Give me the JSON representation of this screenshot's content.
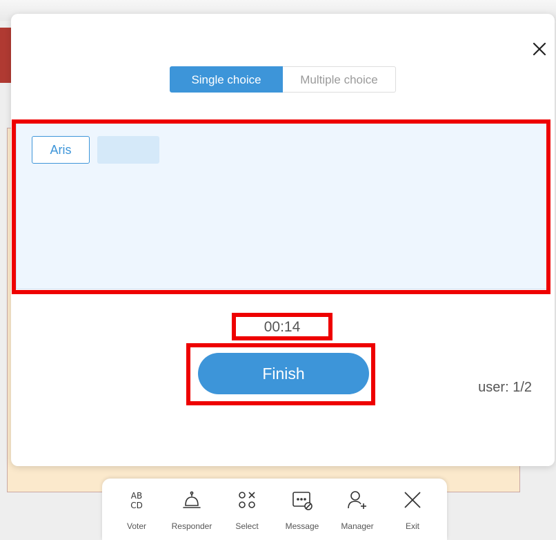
{
  "mode_tabs": [
    {
      "label": "Single choice",
      "active": true
    },
    {
      "label": "Multiple choice",
      "active": false
    }
  ],
  "responses": {
    "chips": [
      "Aris",
      ""
    ],
    "user_count": "user: 1/2"
  },
  "timer": "00:14",
  "finish_label": "Finish",
  "toolbar": [
    {
      "label": "Voter",
      "icon": "abcd-icon"
    },
    {
      "label": "Responder",
      "icon": "bell-icon"
    },
    {
      "label": "Select",
      "icon": "select-icon"
    },
    {
      "label": "Message",
      "icon": "message-icon"
    },
    {
      "label": "Manager",
      "icon": "add-user-icon"
    },
    {
      "label": "Exit",
      "icon": "close-icon"
    }
  ],
  "colors": {
    "accent": "#3d95d9",
    "highlight": "#ee0000",
    "answer_bg": "#eef6fe"
  }
}
